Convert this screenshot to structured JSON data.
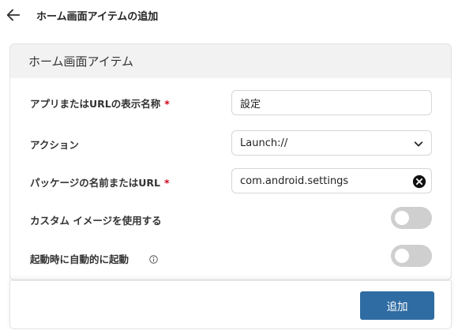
{
  "header": {
    "back_icon": "arrow-left-icon",
    "title": "ホーム画面アイテムの追加"
  },
  "section": {
    "title": "ホーム画面アイテム"
  },
  "form": {
    "app_name": {
      "label": "アプリまたはURLの表示名称",
      "required_mark": "*",
      "value": "設定"
    },
    "action": {
      "label": "アクション",
      "selected": "Launch://",
      "icon": "chevron-down-icon"
    },
    "package": {
      "label": "パッケージの名前またはURL",
      "required_mark": "*",
      "value": "com.android.settings",
      "clear_icon": "clear-circle-icon"
    },
    "custom_image": {
      "label": "カスタム イメージを使用する",
      "enabled": false
    },
    "autostart": {
      "label": "起動時に自動的に起動",
      "info_icon": "info-icon",
      "enabled": false
    }
  },
  "footer": {
    "add_label": "追加"
  },
  "colors": {
    "primary": "#2f6ca3",
    "required": "#d0021b",
    "toggle_off": "#cfcfcf",
    "section_header_bg": "#f2f2f2"
  }
}
